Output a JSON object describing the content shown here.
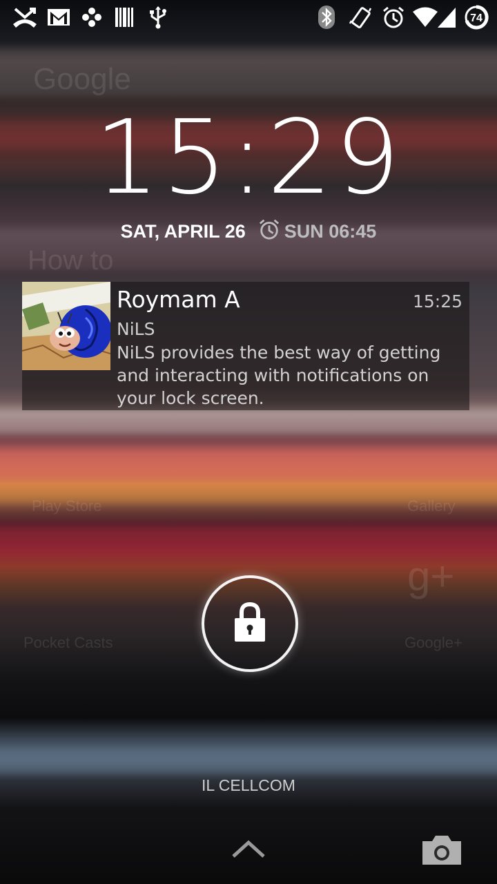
{
  "status_bar": {
    "icons_left": [
      "missed-call-icon",
      "gmail-icon",
      "pinwheel-app-icon",
      "barcode-app-icon",
      "usb-icon"
    ],
    "icons_right": [
      "bluetooth-icon",
      "vibrate-icon",
      "alarm-icon",
      "wifi-icon",
      "signal-icon",
      "battery-icon"
    ],
    "battery_level": "74"
  },
  "lockscreen": {
    "time": "15:29",
    "date": "SAT, APRIL 26",
    "next_alarm": "SUN 06:45"
  },
  "notification": {
    "title": "Roymam A",
    "time": "15:25",
    "app": "NiLS",
    "body": "NiLS provides the best way of getting and interacting with notifications on your lock screen.",
    "icon": "snail-avatar-icon"
  },
  "carrier": "IL CELLCOM",
  "colors": {
    "text_primary": "#ffffff",
    "text_secondary": "#c8c8c8",
    "notification_bg": "rgba(20,16,16,0.55)"
  }
}
